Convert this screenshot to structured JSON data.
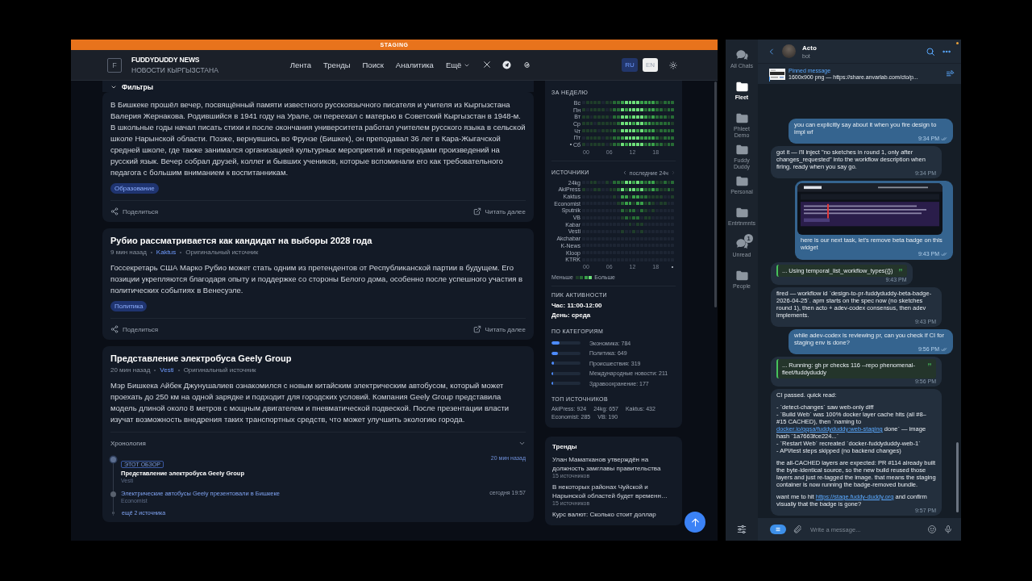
{
  "news": {
    "banner": "STAGING",
    "header": {
      "logo_letter": "F",
      "title": "FUDDYDUDDY NEWS",
      "subtitle": "НОВОСТИ КЫРГЫЗСТАНА",
      "nav": [
        {
          "label": "Лента",
          "kind": "link"
        },
        {
          "label": "Тренды",
          "kind": "link"
        },
        {
          "label": "Поиск",
          "kind": "link"
        },
        {
          "label": "Аналитика",
          "kind": "link"
        },
        {
          "label": "Ещё",
          "kind": "dropdown"
        }
      ],
      "languages": [
        {
          "label": "RU",
          "selected": true
        },
        {
          "label": "EN",
          "selected": false
        }
      ]
    },
    "filters": {
      "label": "Фильтры"
    },
    "articles": [
      {
        "body": "В Бишкеке прошёл вечер, посвящённый памяти известного русскоязычного писателя и учителя из Кыргызстана Валерия Жернакова. Родившийся в 1941 году на Урале, он переехал с матерью в Советский Кыргызстан в 1948-м. В школьные годы начал писать стихи и после окончания университета работал учителем русского языка в сельской школе Нарынской области. Позже, вернувшись во Фрунзе (Бишкек), он преподавал 36 лет в Кара-Жыгачской средней школе, где также занимался организацией культурных мероприятий и переводами произведений на русский язык. Вечер собрал друзей, коллег и бывших учеников, которые вспоминали его как требовательного педагога с большим вниманием к воспитанникам.",
        "tag": "Образование",
        "share": "Поделиться",
        "read_more": "Читать далее"
      },
      {
        "title": "Рубио рассматривается как кандидат на выборы 2028 года",
        "meta": {
          "time": "9 мин назад",
          "source": "Kaktus",
          "original": "Оригинальный источник"
        },
        "body": "Госсекретарь США Марко Рубио может стать одним из претендентов от Республиканской партии в будущем. Его позиции укрепляются благодаря опыту и поддержке со стороны Белого дома, особенно после успешного участия в политических событиях в Венесуэле.",
        "tag": "Политика",
        "share": "Поделиться",
        "read_more": "Читать далее"
      },
      {
        "title": "Представление электробуса Geely Group",
        "meta": {
          "time": "20 мин назад",
          "source": "Vesti",
          "original": "Оригинальный источник"
        },
        "body": "Мэр Бишкека Айбек Джунушалиев ознакомился с новым китайским электрическим автобусом, который может проехать до 250 км на одной зарядке и подходит для городских условий. Компания Geely Group представила модель длиной около 8 метров с мощным двигателем и пневматической подвеской. После презентации власти изучат возможность внедрения таких транспортных средств, что может улучшить экологию города.",
        "timeline": {
          "label": "Хронология",
          "items": [
            {
              "current": true,
              "badge": "ЭТОТ ОБЗОР",
              "title": "Представление электробуса Geely Group",
              "source": "Vesti",
              "time": "20 мин назад"
            },
            {
              "current": false,
              "title": "Электрические автобусы Geely презентовали в Бишкеке",
              "source": "Economist",
              "time": "сегодня 19:57"
            }
          ],
          "more": "ещё 2 источника"
        }
      }
    ],
    "stats": {
      "week": {
        "title": "ЗА НЕДЕЛЮ",
        "hours": [
          "00",
          "06",
          "12",
          "18"
        ],
        "rows": [
          {
            "label": "Вс",
            "today": false
          },
          {
            "label": "Пн",
            "today": false
          },
          {
            "label": "Вт",
            "today": false
          },
          {
            "label": "Ср",
            "today": false
          },
          {
            "label": "Чт",
            "today": false
          },
          {
            "label": "Пт",
            "today": false
          },
          {
            "label": "Сб",
            "today": true
          }
        ]
      },
      "sources": {
        "title": "ИСТОЧНИКИ",
        "range": "последние 24ч",
        "hours": [
          "00",
          "06",
          "12",
          "18"
        ],
        "rows": [
          {
            "label": "24kg"
          },
          {
            "label": "AkiPress"
          },
          {
            "label": "Kaktus"
          },
          {
            "label": "Economist"
          },
          {
            "label": "Sputnik"
          },
          {
            "label": "VB"
          },
          {
            "label": "Kabar"
          },
          {
            "label": "Vesti"
          },
          {
            "label": "Akchabar"
          },
          {
            "label": "K-News"
          },
          {
            "label": "Kloop"
          },
          {
            "label": "KTRK"
          }
        ],
        "legend_less": "Меньше",
        "legend_more": "Больше"
      },
      "peak": {
        "title": "ПИК АКТИВНОСТИ",
        "hour": "Час: 11:00-12:00",
        "day": "День: среда"
      },
      "categories": {
        "title": "ПО КАТЕГОРИЯМ",
        "items": [
          {
            "label": "Экономика: 784",
            "level": 0.27
          },
          {
            "label": "Политика: 649",
            "level": 0.22
          },
          {
            "label": "Происшествия: 319",
            "level": 0.09
          },
          {
            "label": "Международные новости: 211",
            "level": 0.06
          },
          {
            "label": "Здравоохранение: 177",
            "level": 0.05
          }
        ]
      },
      "top_sources": {
        "title": "ТОП ИСТОЧНИКОВ",
        "items": [
          "AkiPress: 924",
          "24kg: 657",
          "Kaktus: 432",
          "Economist: 285",
          "VB: 190"
        ]
      }
    },
    "trends": {
      "title": "Тренды",
      "items": [
        {
          "title": "Улан Маматканов утверждён на должность замглавы правительства",
          "count": "15 источников"
        },
        {
          "title": "В некоторых районах Чуйской и Нарынской областей будет временн…",
          "count": "15 источников"
        },
        {
          "title": "Курс валют: Сколько стоит доллар"
        }
      ]
    }
  },
  "messenger": {
    "folders": [
      {
        "label": "All Chats",
        "kind": "chats",
        "selected": false
      },
      {
        "label": "Fleet",
        "kind": "folder",
        "selected": true
      },
      {
        "label": "Phleet Demo",
        "kind": "folder",
        "selected": false
      },
      {
        "label": "Fuddy Duddy",
        "kind": "folder",
        "selected": false
      },
      {
        "label": "Personal",
        "kind": "folder",
        "selected": false
      },
      {
        "label": "Entrtnmnts",
        "kind": "folder",
        "selected": false
      },
      {
        "label": "Unread",
        "kind": "chats",
        "selected": false,
        "badge": "1"
      },
      {
        "label": "People",
        "kind": "folder",
        "selected": false
      }
    ],
    "chat": {
      "name": "Acto",
      "status": "bot"
    },
    "pinned": {
      "title": "Pinned message",
      "text": "1600x900 png — https://share.anvarlab.com/cto/p..."
    },
    "messages": [
      {
        "kind": "text",
        "out": true,
        "read": true,
        "text": "you can explicitly say about it when you fire design to impl wf",
        "time": "9:34 PM"
      },
      {
        "kind": "text",
        "out": false,
        "read": false,
        "text": "got it — i'll inject \"no sketches in round 1, only after changes_requested\" into the workflow description when firing. ready when you say go.",
        "time": "9:34 PM"
      },
      {
        "out": true,
        "read": true,
        "text": "here is our next task, let's remove beta badge on this widget",
        "time": "9:43 PM"
      },
      {
        "kind": "tool",
        "out": false,
        "read": false,
        "text": "... Using temporal_list_workflow_types({})",
        "time": "9:43 PM"
      },
      {
        "kind": "text",
        "out": false,
        "read": false,
        "text": "fired — workflow id `design-to-pr-fuddyduddy-beta-badge-2026-04-25`. apm starts on the spec now (no sketches round 1), then acto + adev-codex consensus, then adev implements.",
        "time": "9:43 PM"
      },
      {
        "kind": "text",
        "out": true,
        "read": true,
        "text": "while adev-codex is reviewing pr, can you check if CI for staging env is done?",
        "time": "9:56 PM"
      },
      {
        "kind": "tool",
        "out": false,
        "read": false,
        "text": "... Running: gh pr checks 116 --repo phenomenal-fleet/fuddyduddy",
        "time": "9:56 PM"
      },
      {
        "kind": "rich",
        "out": false,
        "read": false,
        "time": "9:57 PM",
        "blocks": [
          [
            [
              {
                "text": "CI passed. quick read:"
              }
            ]
          ],
          [
            [
              {
                "text": "- `detect-changes` saw web-only diff"
              }
            ],
            [
              {
                "text": "- `Build Web` was 100% docker layer cache hits (all #8–#15 CACHED), then `naming to "
              },
              {
                "link": "docker.io/gqsa/fuddyduddy:web-staging"
              },
              {
                "text": " done` — image hash `1a7663fce224...`"
              }
            ],
            [
              {
                "text": "- `Restart Web` recreated `docker-fuddyduddy-web-1`"
              }
            ],
            [
              {
                "text": "- API/test steps skipped (no backend changes)"
              }
            ]
          ],
          [
            [
              {
                "text": "the all-CACHED layers are expected: PR #114 already built the byte-identical source, so the new build reused those layers and just re-tagged the image. that means the staging container is now running the badge-removed bundle."
              }
            ]
          ],
          [
            [
              {
                "text": "want me to hit "
              },
              {
                "link": "https://stage.fuddy-duddy.org"
              },
              {
                "text": " and confirm visually that the badge is gone?"
              }
            ]
          ]
        ]
      }
    ],
    "input": {
      "placeholder": "Write a message..."
    }
  }
}
